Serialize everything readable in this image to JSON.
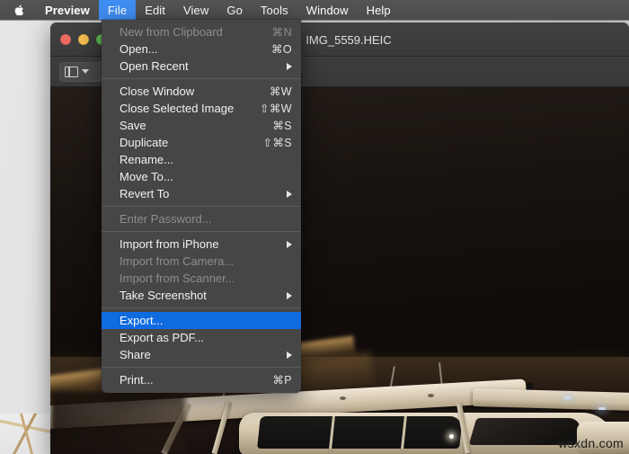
{
  "menubar": {
    "apple_icon": "apple-logo-icon",
    "items": [
      {
        "label": "Preview",
        "bold": true,
        "active": false
      },
      {
        "label": "File",
        "bold": false,
        "active": true
      },
      {
        "label": "Edit",
        "bold": false,
        "active": false
      },
      {
        "label": "View",
        "bold": false,
        "active": false
      },
      {
        "label": "Go",
        "bold": false,
        "active": false
      },
      {
        "label": "Tools",
        "bold": false,
        "active": false
      },
      {
        "label": "Window",
        "bold": false,
        "active": false
      },
      {
        "label": "Help",
        "bold": false,
        "active": false
      }
    ]
  },
  "window": {
    "title": "IMG_5559.HEIC",
    "doc_icon": "document-image-icon",
    "traffic_lights": {
      "close": "close-window-button",
      "minimize": "minimize-window-button",
      "maximize": "maximize-window-button"
    },
    "toolbar": {
      "sidebar_toggle_icon": "sidebar-toggle-icon",
      "chevron_icon": "chevron-down-icon"
    }
  },
  "file_menu": {
    "title": "File",
    "highlight_color": "#0f6ce0",
    "items": [
      {
        "label": "New from Clipboard",
        "shortcut": "⌘N",
        "disabled": true,
        "submenu": false,
        "selected": false
      },
      {
        "label": "Open...",
        "shortcut": "⌘O",
        "disabled": false,
        "submenu": false,
        "selected": false
      },
      {
        "label": "Open Recent",
        "shortcut": "",
        "disabled": false,
        "submenu": true,
        "selected": false
      },
      {
        "separator": true
      },
      {
        "label": "Close Window",
        "shortcut": "⌘W",
        "disabled": false,
        "submenu": false,
        "selected": false
      },
      {
        "label": "Close Selected Image",
        "shortcut": "⇧⌘W",
        "disabled": false,
        "submenu": false,
        "selected": false
      },
      {
        "label": "Save",
        "shortcut": "⌘S",
        "disabled": false,
        "submenu": false,
        "selected": false
      },
      {
        "label": "Duplicate",
        "shortcut": "⇧⌘S",
        "disabled": false,
        "submenu": false,
        "selected": false
      },
      {
        "label": "Rename...",
        "shortcut": "",
        "disabled": false,
        "submenu": false,
        "selected": false
      },
      {
        "label": "Move To...",
        "shortcut": "",
        "disabled": false,
        "submenu": false,
        "selected": false
      },
      {
        "label": "Revert To",
        "shortcut": "",
        "disabled": false,
        "submenu": true,
        "selected": false
      },
      {
        "separator": true
      },
      {
        "label": "Enter Password...",
        "shortcut": "",
        "disabled": true,
        "submenu": false,
        "selected": false
      },
      {
        "separator": true
      },
      {
        "label": "Import from iPhone",
        "shortcut": "",
        "disabled": false,
        "submenu": true,
        "selected": false
      },
      {
        "label": "Import from Camera...",
        "shortcut": "",
        "disabled": true,
        "submenu": false,
        "selected": false
      },
      {
        "label": "Import from Scanner...",
        "shortcut": "",
        "disabled": true,
        "submenu": false,
        "selected": false
      },
      {
        "label": "Take Screenshot",
        "shortcut": "",
        "disabled": false,
        "submenu": true,
        "selected": false
      },
      {
        "separator": true
      },
      {
        "label": "Export...",
        "shortcut": "",
        "disabled": false,
        "submenu": false,
        "selected": true
      },
      {
        "label": "Export as PDF...",
        "shortcut": "",
        "disabled": false,
        "submenu": false,
        "selected": false
      },
      {
        "label": "Share",
        "shortcut": "",
        "disabled": false,
        "submenu": true,
        "selected": false
      },
      {
        "separator": true
      },
      {
        "label": "Print...",
        "shortcut": "⌘P",
        "disabled": false,
        "submenu": false,
        "selected": false
      }
    ]
  },
  "photo": {
    "description": "night-photo-airplane",
    "watermark": "wsxdn.com"
  }
}
